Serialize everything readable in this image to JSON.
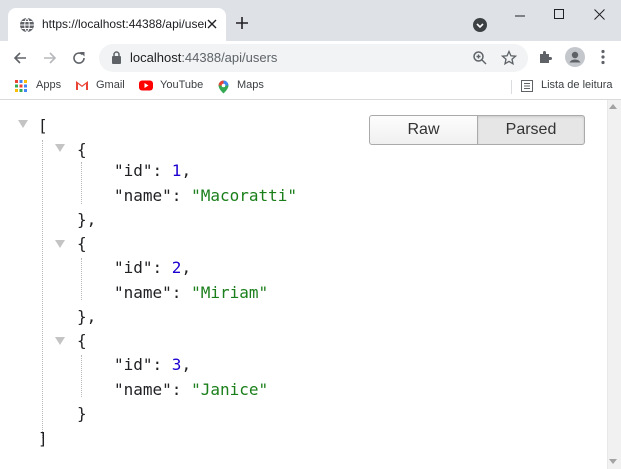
{
  "tab": {
    "title": "https://localhost:44388/api/users",
    "favicon": "globe-icon",
    "close_icon": "close-icon"
  },
  "omnibox": {
    "host": "localhost",
    "rest": ":44388/api/users"
  },
  "bookmarks": [
    {
      "label": "Apps",
      "icon": "apps-grid-icon"
    },
    {
      "label": "Gmail",
      "icon": "gmail-icon"
    },
    {
      "label": "YouTube",
      "icon": "youtube-icon"
    },
    {
      "label": "Maps",
      "icon": "maps-icon"
    }
  ],
  "reading_list": {
    "label": "Lista de leitura",
    "icon": "reading-list-icon"
  },
  "viewer": {
    "raw_label": "Raw",
    "parsed_label": "Parsed",
    "selected": "Parsed"
  },
  "json": {
    "open_bracket": "[",
    "close_bracket": "]",
    "items": [
      {
        "id_key": "\"id\"",
        "id_value": "1",
        "name_key": "\"name\"",
        "name_value": "\"Macoratti\"",
        "close": "},"
      },
      {
        "id_key": "\"id\"",
        "id_value": "2",
        "name_key": "\"name\"",
        "name_value": "\"Miriam\"",
        "close": "},"
      },
      {
        "id_key": "\"id\"",
        "id_value": "3",
        "name_key": "\"name\"",
        "name_value": "\"Janice\"",
        "close": "}"
      }
    ]
  },
  "colors": {
    "string": "#1a7f1a",
    "number": "#1c00cf",
    "tabstrip": "#dee1e6"
  }
}
